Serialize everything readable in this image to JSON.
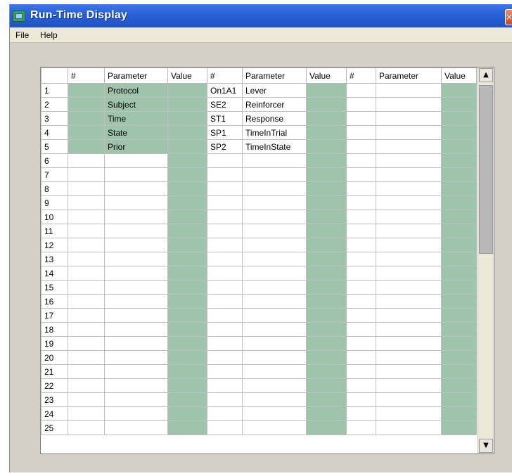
{
  "window": {
    "title": "Run-Time Display",
    "close_label": "×"
  },
  "menu": {
    "items": [
      "File",
      "Help"
    ]
  },
  "grid": {
    "headers": [
      "#",
      "Parameter",
      "Value",
      "#",
      "Parameter",
      "Value",
      "#",
      "Parameter",
      "Value"
    ],
    "rows": [
      {
        "label": "1",
        "cells": [
          "",
          "Protocol",
          "",
          "On1A1",
          "Lever",
          "",
          "",
          "",
          ""
        ]
      },
      {
        "label": "2",
        "cells": [
          "",
          "Subject",
          "",
          "SE2",
          "Reinforcer",
          "",
          "",
          "",
          ""
        ]
      },
      {
        "label": "3",
        "cells": [
          "",
          "Time",
          "",
          "ST1",
          "Response",
          "",
          "",
          "",
          ""
        ]
      },
      {
        "label": "4",
        "cells": [
          "",
          "State",
          "",
          "SP1",
          "TimeInTrial",
          "",
          "",
          "",
          ""
        ]
      },
      {
        "label": "5",
        "cells": [
          "",
          "Prior",
          "",
          "SP2",
          "TimeInState",
          "",
          "",
          "",
          ""
        ]
      },
      {
        "label": "6",
        "cells": [
          "",
          "",
          "",
          "",
          "",
          "",
          "",
          "",
          ""
        ]
      },
      {
        "label": "7",
        "cells": [
          "",
          "",
          "",
          "",
          "",
          "",
          "",
          "",
          ""
        ]
      },
      {
        "label": "8",
        "cells": [
          "",
          "",
          "",
          "",
          "",
          "",
          "",
          "",
          ""
        ]
      },
      {
        "label": "9",
        "cells": [
          "",
          "",
          "",
          "",
          "",
          "",
          "",
          "",
          ""
        ]
      },
      {
        "label": "10",
        "cells": [
          "",
          "",
          "",
          "",
          "",
          "",
          "",
          "",
          ""
        ]
      },
      {
        "label": "11",
        "cells": [
          "",
          "",
          "",
          "",
          "",
          "",
          "",
          "",
          ""
        ]
      },
      {
        "label": "12",
        "cells": [
          "",
          "",
          "",
          "",
          "",
          "",
          "",
          "",
          ""
        ]
      },
      {
        "label": "13",
        "cells": [
          "",
          "",
          "",
          "",
          "",
          "",
          "",
          "",
          ""
        ]
      },
      {
        "label": "14",
        "cells": [
          "",
          "",
          "",
          "",
          "",
          "",
          "",
          "",
          ""
        ]
      },
      {
        "label": "15",
        "cells": [
          "",
          "",
          "",
          "",
          "",
          "",
          "",
          "",
          ""
        ]
      },
      {
        "label": "16",
        "cells": [
          "",
          "",
          "",
          "",
          "",
          "",
          "",
          "",
          ""
        ]
      },
      {
        "label": "17",
        "cells": [
          "",
          "",
          "",
          "",
          "",
          "",
          "",
          "",
          ""
        ]
      },
      {
        "label": "18",
        "cells": [
          "",
          "",
          "",
          "",
          "",
          "",
          "",
          "",
          ""
        ]
      },
      {
        "label": "19",
        "cells": [
          "",
          "",
          "",
          "",
          "",
          "",
          "",
          "",
          ""
        ]
      },
      {
        "label": "20",
        "cells": [
          "",
          "",
          "",
          "",
          "",
          "",
          "",
          "",
          ""
        ]
      },
      {
        "label": "21",
        "cells": [
          "",
          "",
          "",
          "",
          "",
          "",
          "",
          "",
          ""
        ]
      },
      {
        "label": "22",
        "cells": [
          "",
          "",
          "",
          "",
          "",
          "",
          "",
          "",
          ""
        ]
      },
      {
        "label": "23",
        "cells": [
          "",
          "",
          "",
          "",
          "",
          "",
          "",
          "",
          ""
        ]
      },
      {
        "label": "24",
        "cells": [
          "",
          "",
          "",
          "",
          "",
          "",
          "",
          "",
          ""
        ]
      },
      {
        "label": "25",
        "cells": [
          "",
          "",
          "",
          "",
          "",
          "",
          "",
          "",
          ""
        ]
      }
    ]
  },
  "scrollbar": {
    "up_arrow": "▲",
    "down_arrow": "▼"
  },
  "colors": {
    "title_bar": "#2a62d8",
    "value_cell": "#9ec5ac",
    "window_bg": "#d4d0c8"
  }
}
